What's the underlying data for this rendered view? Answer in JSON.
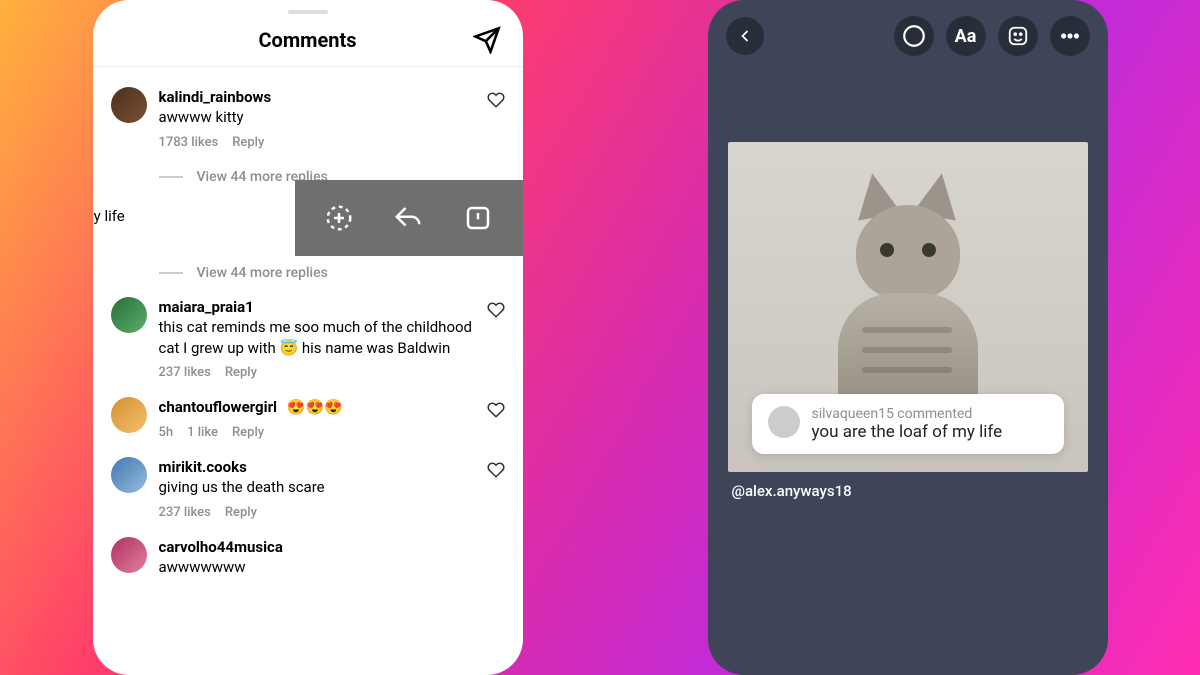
{
  "left": {
    "title": "Comments",
    "partial": "my life",
    "comments": [
      {
        "user": "kalindi_rainbows",
        "text": "awwww kitty",
        "likes": "1783 likes",
        "reply": "Reply",
        "view_replies": "View 44 more replies"
      },
      {
        "user": "",
        "text": "",
        "likes": "",
        "reply": "",
        "view_replies": "View 44 more replies"
      },
      {
        "user": "maiara_praia1",
        "text": "this cat reminds me soo much of the childhood cat I grew up with 😇 his name was Baldwin",
        "likes": "237 likes",
        "reply": "Reply"
      },
      {
        "user": "chantouflowergirl",
        "text": "😍😍😍",
        "time": "5h",
        "like_count": "1 like",
        "reply": "Reply"
      },
      {
        "user": "mirikit.cooks",
        "text": "giving us the death scare",
        "likes": "237 likes",
        "reply": "Reply"
      },
      {
        "user": "carvolho44musica",
        "text": "awwwwwww"
      }
    ]
  },
  "right": {
    "card_user": "silvaqueen15 commented",
    "card_text": "you are the loaf of my life",
    "mention": "@alex.anyways18",
    "aa_label": "Aa"
  }
}
